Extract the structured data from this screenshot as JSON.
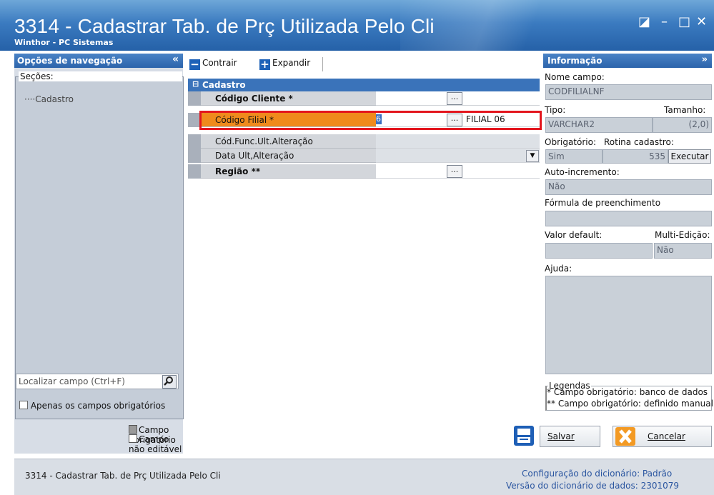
{
  "window": {
    "title": "3314 - Cadastrar Tab. de Prç Utilizada Pelo Cli",
    "subtitle": "Winthor - PC Sistemas"
  },
  "nav": {
    "header": "Opções de navegação",
    "sections_label": "Seções:",
    "section_item": "Cadastro",
    "search_placeholder": "Localizar campo (Ctrl+F)",
    "only_required_label": "Apenas os campos obrigatórios",
    "legend_required": "Campo obrigatório",
    "legend_not_editable": "Campo não editável"
  },
  "toolbar": {
    "collapse_label": "Contrair",
    "expand_label": "Expandir"
  },
  "grid": {
    "group_label": "Cadastro",
    "rows": [
      {
        "label": "Código Cliente *",
        "value": ""
      },
      {
        "label": "Código Filial *",
        "value": "6",
        "desc": "FILIAL 06"
      },
      {
        "label": "Cód.Func.Ult.Alteração",
        "value": ""
      },
      {
        "label": "Data Ult,Alteração",
        "value": ""
      },
      {
        "label": "Região **",
        "value": ""
      }
    ],
    "dots_label": "..."
  },
  "info": {
    "header": "Informação",
    "nome_campo_label": "Nome campo:",
    "nome_campo_value": "CODFILIALNF",
    "tipo_label": "Tipo:",
    "tamanho_label": "Tamanho:",
    "tipo_value": "VARCHAR2",
    "tamanho_value": "(2,0)",
    "obrigatorio_label": "Obrigatório:",
    "rotina_label": "Rotina cadastro:",
    "obrigatorio_value": "Sim",
    "rotina_value": "535",
    "executar_label": "Executar",
    "autoinc_label": "Auto-incremento:",
    "autoinc_value": "Não",
    "formula_label": "Fórmula de preenchimento",
    "valor_default_label": "Valor default:",
    "multi_label": "Multi-Edição:",
    "multi_value": "Não",
    "ajuda_label": "Ajuda:",
    "legendas_label": "Legendas",
    "legend_line1": "* Campo obrigatório: banco de dados",
    "legend_line2": "** Campo obrigatório: definido manual"
  },
  "buttons": {
    "save": "Salvar",
    "cancel": "Cancelar"
  },
  "status": {
    "left": "3314 - Cadastrar Tab. de Prç Utilizada Pelo Cli",
    "config_label": "Configuração do dicionário: Padrão",
    "version_label": "Versão do dicionário de dados: 2301079"
  },
  "colors": {
    "accent": "#2c64ab",
    "highlight": "#ef8a1c",
    "red_outline": "#e3161e"
  }
}
